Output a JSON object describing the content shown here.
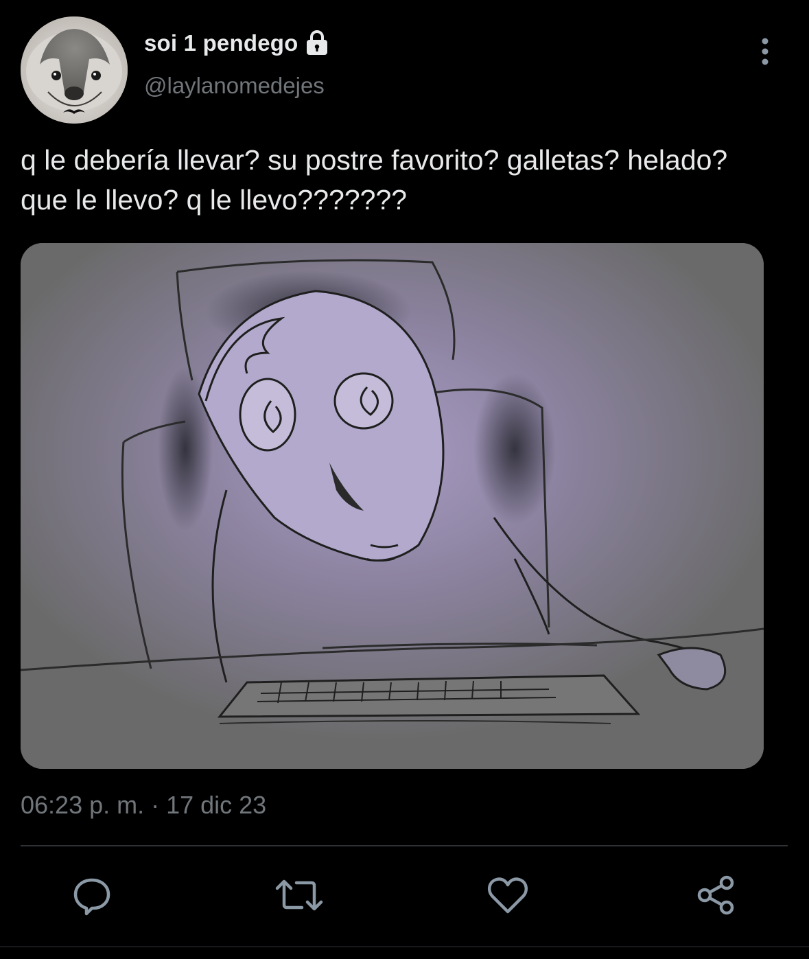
{
  "user": {
    "display_name": "soi 1 pendego",
    "handle": "@laylanomedejes",
    "avatar_icon": "seal-avatar",
    "protected_icon": "lock-icon"
  },
  "tweet": {
    "text": "q le debería llevar? su postre favorito? galletas? helado? que le llevo? q le llevo???????",
    "timestamp": "06:23 p. m. · 17 dic 23",
    "media_description_icon": "stressed-cartoon-image"
  },
  "actions": {
    "reply_icon": "reply-icon",
    "retweet_icon": "retweet-icon",
    "like_icon": "heart-icon",
    "share_icon": "share-icon"
  },
  "colors": {
    "background": "#000000",
    "primary_text": "#e7e9ea",
    "secondary_text": "#71767b",
    "icon": "#8b98a5",
    "divider": "#2f3336"
  }
}
